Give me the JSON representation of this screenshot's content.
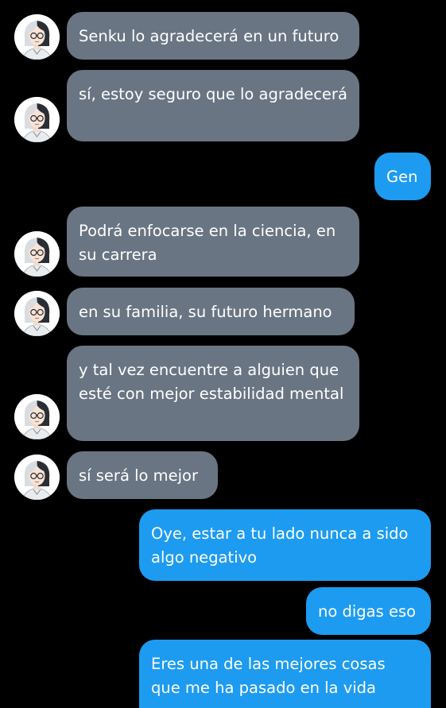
{
  "colors": {
    "background": "#000000",
    "incoming_bubble": "#6a7583",
    "outgoing_bubble": "#1d9bf0",
    "text": "#ffffff"
  },
  "avatar": {
    "icon": "anime-character-avatar-icon"
  },
  "messages": [
    {
      "side": "incoming",
      "text": "Senku lo agradecerá en un futuro"
    },
    {
      "side": "incoming",
      "text": "sí, estoy seguro que lo agradecerá"
    },
    {
      "side": "outgoing",
      "text": "Gen"
    },
    {
      "side": "incoming",
      "text": "Podrá enfocarse en la ciencia, en su carrera"
    },
    {
      "side": "incoming",
      "text": "en su familia, su futuro hermano"
    },
    {
      "side": "incoming",
      "text": "y tal vez encuentre a alguien que esté con mejor estabilidad mental"
    },
    {
      "side": "incoming",
      "text": "sí será lo mejor"
    },
    {
      "side": "outgoing",
      "text": "Oye, estar a tu lado nunca a sido algo negativo"
    },
    {
      "side": "outgoing",
      "text": "no digas eso"
    },
    {
      "side": "outgoing",
      "text": "Eres una de las mejores cosas que me ha pasado en la vida"
    }
  ]
}
